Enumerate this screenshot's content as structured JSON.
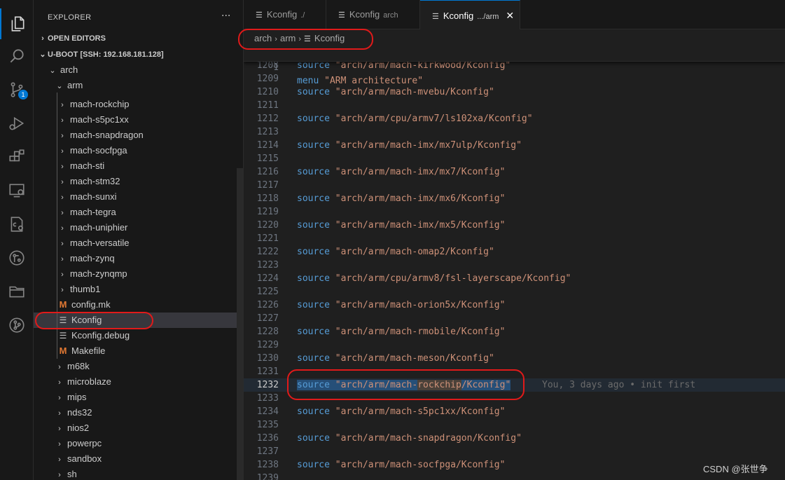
{
  "activity_bar": {
    "icons": [
      "explorer-icon",
      "search-icon",
      "source-control-icon",
      "run-debug-icon",
      "extensions-icon",
      "remote-explorer-icon",
      "c-cpp-settings-icon",
      "gitlens-icon",
      "folder-icon",
      "git-graph-icon"
    ],
    "source_control_badge": "1",
    "accent": "#0078d4"
  },
  "sidebar": {
    "title": "EXPLORER",
    "more": "···",
    "open_editors": "OPEN EDITORS",
    "workspace": "U-BOOT [SSH: 192.168.181.128]",
    "tree": [
      {
        "label": "arch",
        "kind": "folder",
        "open": true,
        "depth": 1
      },
      {
        "label": "arm",
        "kind": "folder",
        "open": true,
        "depth": 2
      },
      {
        "label": "mach-rockchip",
        "kind": "folder",
        "depth": 3
      },
      {
        "label": "mach-s5pc1xx",
        "kind": "folder",
        "depth": 3
      },
      {
        "label": "mach-snapdragon",
        "kind": "folder",
        "depth": 3
      },
      {
        "label": "mach-socfpga",
        "kind": "folder",
        "depth": 3
      },
      {
        "label": "mach-sti",
        "kind": "folder",
        "depth": 3
      },
      {
        "label": "mach-stm32",
        "kind": "folder",
        "depth": 3
      },
      {
        "label": "mach-sunxi",
        "kind": "folder",
        "depth": 3
      },
      {
        "label": "mach-tegra",
        "kind": "folder",
        "depth": 3
      },
      {
        "label": "mach-uniphier",
        "kind": "folder",
        "depth": 3
      },
      {
        "label": "mach-versatile",
        "kind": "folder",
        "depth": 3
      },
      {
        "label": "mach-zynq",
        "kind": "folder",
        "depth": 3
      },
      {
        "label": "mach-zynqmp",
        "kind": "folder",
        "depth": 3
      },
      {
        "label": "thumb1",
        "kind": "folder",
        "depth": 3
      },
      {
        "label": "config.mk",
        "kind": "makefile",
        "depth": 3
      },
      {
        "label": "Kconfig",
        "kind": "text",
        "depth": 3,
        "selected": true
      },
      {
        "label": "Kconfig.debug",
        "kind": "text",
        "depth": 3
      },
      {
        "label": "Makefile",
        "kind": "makefile",
        "depth": 3
      },
      {
        "label": "m68k",
        "kind": "folder",
        "depth": 2
      },
      {
        "label": "microblaze",
        "kind": "folder",
        "depth": 2
      },
      {
        "label": "mips",
        "kind": "folder",
        "depth": 2
      },
      {
        "label": "nds32",
        "kind": "folder",
        "depth": 2
      },
      {
        "label": "nios2",
        "kind": "folder",
        "depth": 2
      },
      {
        "label": "powerpc",
        "kind": "folder",
        "depth": 2
      },
      {
        "label": "sandbox",
        "kind": "folder",
        "depth": 2
      },
      {
        "label": "sh",
        "kind": "folder",
        "depth": 2
      }
    ]
  },
  "tabs": [
    {
      "label": "Kconfig",
      "desc": "./"
    },
    {
      "label": "Kconfig",
      "desc": "arch"
    },
    {
      "label": "Kconfig",
      "desc": ".../arm",
      "active": true,
      "close": "✕"
    }
  ],
  "breadcrumb": [
    "arch",
    "arm",
    "Kconfig"
  ],
  "editor": {
    "sticky": {
      "num": "1",
      "keyword": "menu",
      "string": "\"ARM architecture\""
    },
    "current_line": "1232",
    "blame": "You, 3 days ago • init first",
    "lines": [
      {
        "num": "1208",
        "keyword": "source",
        "string": "\"arch/arm/mach-kirkwood/Kconfig\""
      },
      {
        "num": "1209"
      },
      {
        "num": "1210",
        "keyword": "source",
        "string": "\"arch/arm/mach-mvebu/Kconfig\""
      },
      {
        "num": "1211"
      },
      {
        "num": "1212",
        "keyword": "source",
        "string": "\"arch/arm/cpu/armv7/ls102xa/Kconfig\""
      },
      {
        "num": "1213"
      },
      {
        "num": "1214",
        "keyword": "source",
        "string": "\"arch/arm/mach-imx/mx7ulp/Kconfig\""
      },
      {
        "num": "1215"
      },
      {
        "num": "1216",
        "keyword": "source",
        "string": "\"arch/arm/mach-imx/mx7/Kconfig\""
      },
      {
        "num": "1217"
      },
      {
        "num": "1218",
        "keyword": "source",
        "string": "\"arch/arm/mach-imx/mx6/Kconfig\""
      },
      {
        "num": "1219"
      },
      {
        "num": "1220",
        "keyword": "source",
        "string": "\"arch/arm/mach-imx/mx5/Kconfig\""
      },
      {
        "num": "1221"
      },
      {
        "num": "1222",
        "keyword": "source",
        "string": "\"arch/arm/mach-omap2/Kconfig\""
      },
      {
        "num": "1223"
      },
      {
        "num": "1224",
        "keyword": "source",
        "string": "\"arch/arm/cpu/armv8/fsl-layerscape/Kconfig\""
      },
      {
        "num": "1225"
      },
      {
        "num": "1226",
        "keyword": "source",
        "string": "\"arch/arm/mach-orion5x/Kconfig\""
      },
      {
        "num": "1227"
      },
      {
        "num": "1228",
        "keyword": "source",
        "string": "\"arch/arm/mach-rmobile/Kconfig\""
      },
      {
        "num": "1229"
      },
      {
        "num": "1230",
        "keyword": "source",
        "string": "\"arch/arm/mach-meson/Kconfig\""
      },
      {
        "num": "1231"
      },
      {
        "num": "1232",
        "keyword": "source",
        "string_pre": "\"arch/arm/mach-",
        "string_match": "rockchip",
        "string_post": "/Kconfig\"",
        "current": true
      },
      {
        "num": "1233"
      },
      {
        "num": "1234",
        "keyword": "source",
        "string": "\"arch/arm/mach-s5pc1xx/Kconfig\""
      },
      {
        "num": "1235"
      },
      {
        "num": "1236",
        "keyword": "source",
        "string": "\"arch/arm/mach-snapdragon/Kconfig\""
      },
      {
        "num": "1237"
      },
      {
        "num": "1238",
        "keyword": "source",
        "string": "\"arch/arm/mach-socfpga/Kconfig\""
      },
      {
        "num": "1239"
      }
    ]
  },
  "watermark": "CSDN @张世争",
  "annotation_color": "#e01a1a"
}
